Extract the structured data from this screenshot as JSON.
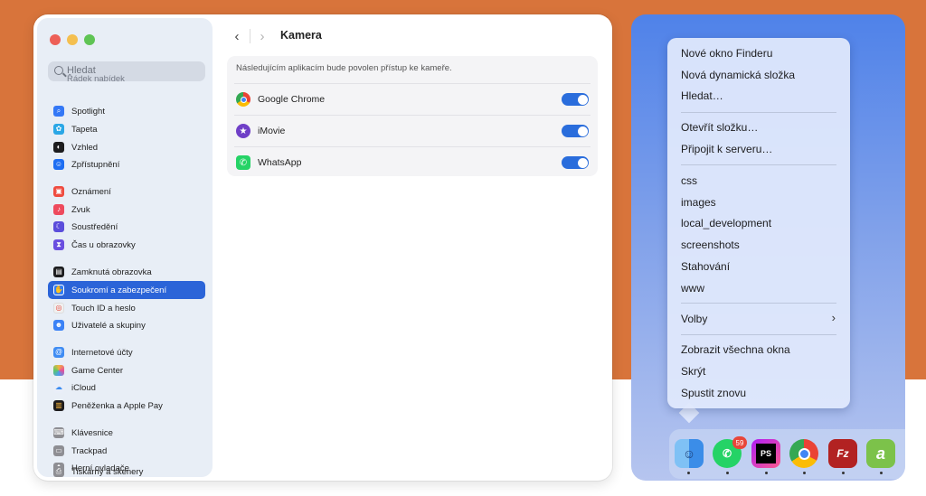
{
  "settings": {
    "search_placeholder": "Hledat",
    "ghost_item": "Řádek nabídek",
    "page_title": "Kamera",
    "back_glyph": "‹",
    "forward_glyph": "›",
    "description": "Následujícím aplikacím bude povolen přístup ke kameře.",
    "sidebar_items": [
      {
        "label": "Spotlight",
        "icon": "spotlight-icon",
        "color": "#3478f6"
      },
      {
        "label": "Tapeta",
        "icon": "wallpaper-icon",
        "color": "#2aa7e6"
      },
      {
        "label": "Vzhled",
        "icon": "appearance-icon",
        "color": "#1c1c1e"
      },
      {
        "label": "Zpřístupnění",
        "icon": "accessibility-icon",
        "color": "#1e6ef2"
      },
      {
        "label": "Oznámení",
        "icon": "notifications-icon",
        "color": "#ef4b3f"
      },
      {
        "label": "Zvuk",
        "icon": "sound-icon",
        "color": "#ee4a5d"
      },
      {
        "label": "Soustředění",
        "icon": "focus-icon",
        "color": "#5b4ddb"
      },
      {
        "label": "Čas u obrazovky",
        "icon": "screen-time-icon",
        "color": "#6a4ee0"
      },
      {
        "label": "Zamknutá obrazovka",
        "icon": "lock-screen-icon",
        "color": "#1c1c1e"
      },
      {
        "label": "Soukromí a zabezpečení",
        "icon": "privacy-hand-icon",
        "color": "#2f7cf6"
      },
      {
        "label": "Touch ID a heslo",
        "icon": "touch-id-icon",
        "color": "#f0f0f0"
      },
      {
        "label": "Uživatelé a skupiny",
        "icon": "users-icon",
        "color": "#3b82f6"
      },
      {
        "label": "Internetové účty",
        "icon": "internet-accounts-icon",
        "color": "#3f8cf3"
      },
      {
        "label": "Game Center",
        "icon": "game-center-icon",
        "color": "#e9e9ee"
      },
      {
        "label": "iCloud",
        "icon": "icloud-icon",
        "color": "#e9eef8"
      },
      {
        "label": "Peněženka a Apple Pay",
        "icon": "wallet-icon",
        "color": "#1c1c1e"
      },
      {
        "label": "Klávesnice",
        "icon": "keyboard-icon",
        "color": "#8e8e93"
      },
      {
        "label": "Trackpad",
        "icon": "trackpad-icon",
        "color": "#8e8e93"
      },
      {
        "label": "Herní ovladače",
        "icon": "game-controller-icon",
        "color": "#8e8e93"
      },
      {
        "label": "Tiskárny a skenery",
        "icon": "printer-icon",
        "color": "#8e8e93"
      }
    ],
    "apps": [
      {
        "name": "Google Chrome",
        "icon": "chrome-icon",
        "enabled": true
      },
      {
        "name": "iMovie",
        "icon": "imovie-icon",
        "enabled": true
      },
      {
        "name": "WhatsApp",
        "icon": "whatsapp-icon",
        "enabled": true
      }
    ],
    "accent_color": "#2b64d8"
  },
  "menu": {
    "items": [
      "Nové okno Finderu",
      "Nová dynamická složka",
      "Hledat…",
      "Otevřít složku…",
      "Připojit k serveru…",
      "css",
      "images",
      "local_development",
      "screenshots",
      "Stahování",
      "www",
      "Volby",
      "Zobrazit všechna okna",
      "Skrýt",
      "Spustit znovu"
    ],
    "submenu_glyph": "›"
  },
  "dock": {
    "apps": [
      {
        "name": "finder-icon",
        "label": ""
      },
      {
        "name": "whatsapp-icon",
        "label": ""
      },
      {
        "name": "phpstorm-icon",
        "label": "PS"
      },
      {
        "name": "chrome-icon",
        "label": ""
      },
      {
        "name": "filezilla-icon",
        "label": "Fz"
      },
      {
        "name": "android-studio-icon",
        "label": "a"
      }
    ],
    "whatsapp_badge": "59"
  }
}
